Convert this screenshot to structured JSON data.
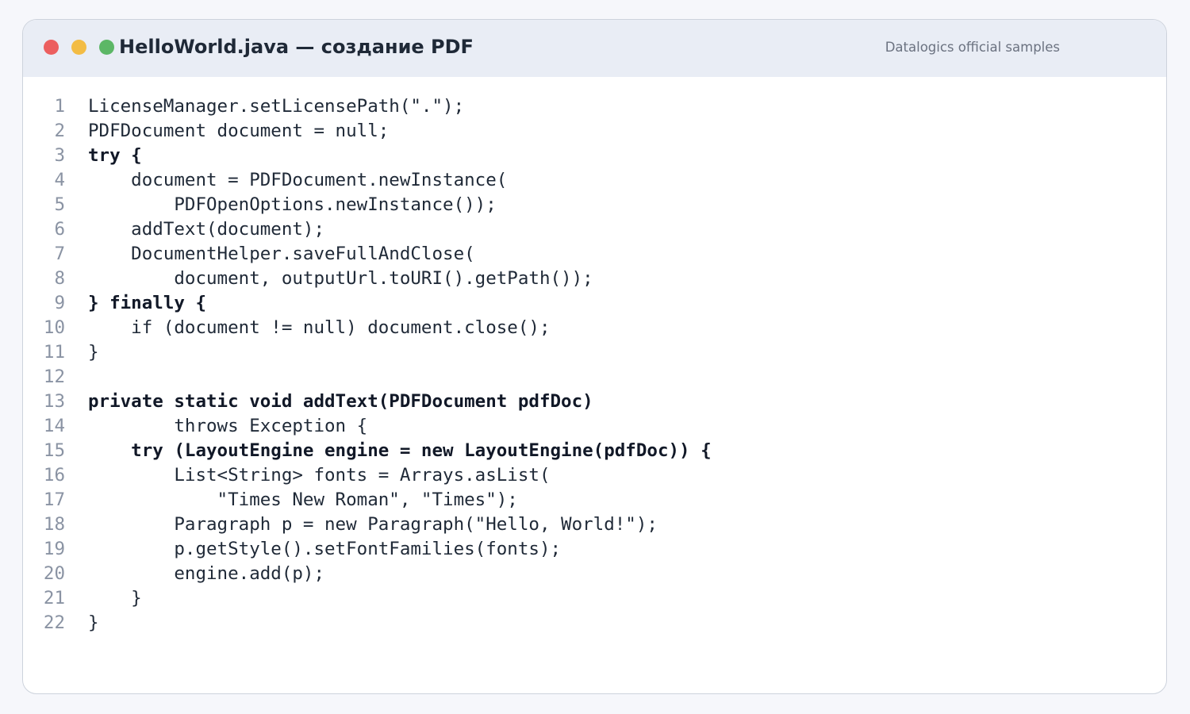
{
  "window": {
    "title": "HelloWorld.java — создание PDF",
    "subtitle": "Datalogics official samples",
    "controls": {
      "close_color": "#ec5f5f",
      "minimize_color": "#f3bc44",
      "zoom_color": "#5cb766"
    }
  },
  "code": {
    "language": "java",
    "lines": [
      {
        "number": "1",
        "text": "LicenseManager.setLicensePath(\".\");",
        "bold": false
      },
      {
        "number": "2",
        "text": "PDFDocument document = null;",
        "bold": false
      },
      {
        "number": "3",
        "text": "try {",
        "bold": true
      },
      {
        "number": "4",
        "text": "    document = PDFDocument.newInstance(",
        "bold": false
      },
      {
        "number": "5",
        "text": "        PDFOpenOptions.newInstance());",
        "bold": false
      },
      {
        "number": "6",
        "text": "    addText(document);",
        "bold": false
      },
      {
        "number": "7",
        "text": "    DocumentHelper.saveFullAndClose(",
        "bold": false
      },
      {
        "number": "8",
        "text": "        document, outputUrl.toURI().getPath());",
        "bold": false
      },
      {
        "number": "9",
        "text": "} finally {",
        "bold": true
      },
      {
        "number": "10",
        "text": "    if (document != null) document.close();",
        "bold": false
      },
      {
        "number": "11",
        "text": "}",
        "bold": false
      },
      {
        "number": "12",
        "text": "",
        "bold": false
      },
      {
        "number": "13",
        "text": "private static void addText(PDFDocument pdfDoc)",
        "bold": true
      },
      {
        "number": "14",
        "text": "        throws Exception {",
        "bold": false
      },
      {
        "number": "15",
        "text": "    try (LayoutEngine engine = new LayoutEngine(pdfDoc)) {",
        "bold": true
      },
      {
        "number": "16",
        "text": "        List<String> fonts = Arrays.asList(",
        "bold": false
      },
      {
        "number": "17",
        "text": "            \"Times New Roman\", \"Times\");",
        "bold": false
      },
      {
        "number": "18",
        "text": "        Paragraph p = new Paragraph(\"Hello, World!\");",
        "bold": false
      },
      {
        "number": "19",
        "text": "        p.getStyle().setFontFamilies(fonts);",
        "bold": false
      },
      {
        "number": "20",
        "text": "        engine.add(p);",
        "bold": false
      },
      {
        "number": "21",
        "text": "    }",
        "bold": false
      },
      {
        "number": "22",
        "text": "}",
        "bold": false
      }
    ]
  }
}
